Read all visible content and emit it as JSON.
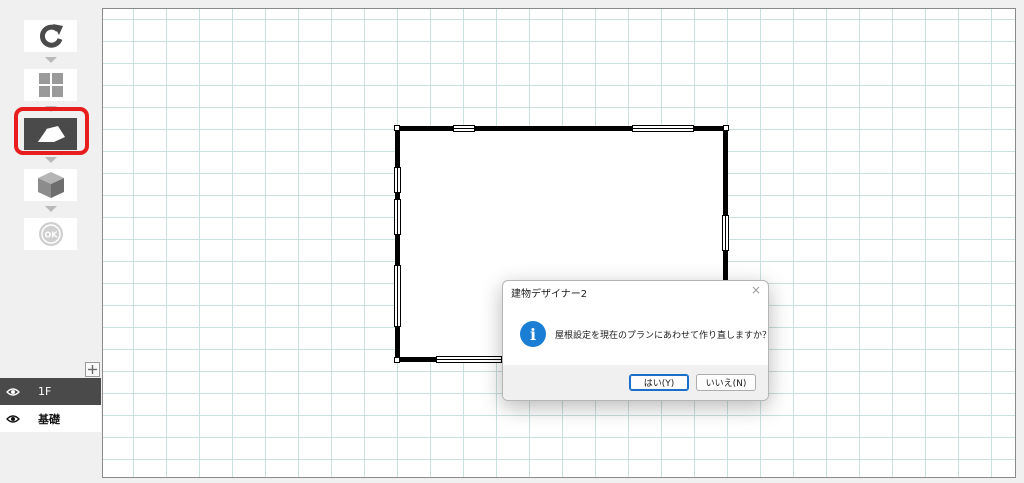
{
  "toolbar": {
    "tools": [
      {
        "name": "refresh",
        "icon": "refresh-icon"
      },
      {
        "name": "floor-plan",
        "icon": "grid-icon"
      },
      {
        "name": "roof",
        "icon": "roof-icon",
        "selected": true
      },
      {
        "name": "3d-view",
        "icon": "cube-icon"
      },
      {
        "name": "ok",
        "icon": "ok-icon",
        "label": "OK"
      }
    ],
    "highlight_color": "#e81e1e"
  },
  "layers": {
    "add_icon": "plus-icon",
    "items": [
      {
        "label": "1F",
        "selected": true,
        "icon": "eye-icon"
      },
      {
        "label": "基礎",
        "selected": false,
        "icon": "eye-icon"
      }
    ]
  },
  "dialog": {
    "title": "建物デザイナー2",
    "close": "×",
    "icon": "info-icon",
    "icon_glyph": "i",
    "message": "屋根設定を現在のプランにあわせて作り直しますか？",
    "yes_label": "はい(Y)",
    "no_label": "いいえ(N)",
    "accent_color": "#1a7fd4"
  }
}
